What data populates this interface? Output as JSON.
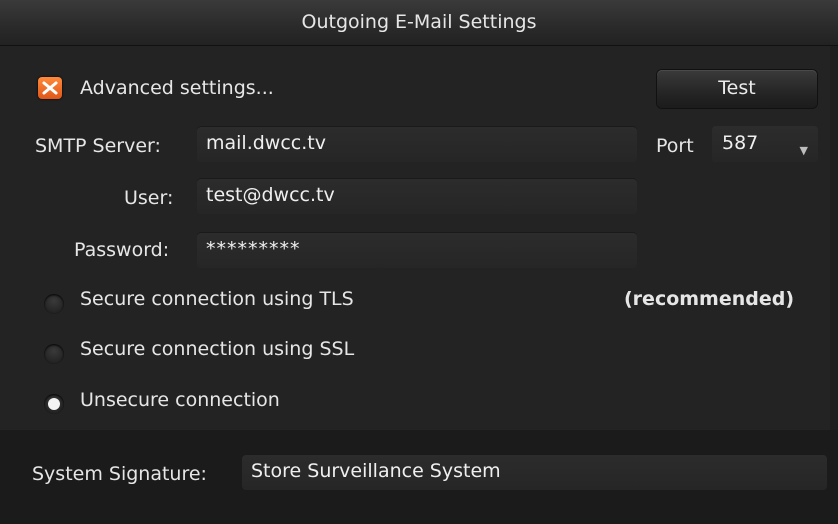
{
  "window": {
    "title": "Outgoing E-Mail Settings"
  },
  "advanced": {
    "label": "Advanced settings...",
    "checked": true
  },
  "test_button": {
    "label": "Test"
  },
  "smtp": {
    "server_label": "SMTP Server:",
    "server_value": "mail.dwcc.tv",
    "port_label": "Port",
    "port_value": "587",
    "user_label": "User:",
    "user_value": "test@dwcc.tv",
    "password_label": "Password:",
    "password_value": "*********"
  },
  "security": {
    "options": [
      {
        "label": "Secure connection using TLS",
        "selected": false
      },
      {
        "label": "Secure connection using SSL",
        "selected": false
      },
      {
        "label": "Unsecure connection",
        "selected": true
      }
    ],
    "recommended_note": "(recommended)"
  },
  "signature": {
    "label": "System Signature:",
    "value": "Store Surveillance System"
  },
  "colors": {
    "accent": "#f07a2a",
    "background": "#232323"
  },
  "icons": {
    "checkbox": "x-check-icon",
    "dropdown": "chevron-down-icon"
  }
}
